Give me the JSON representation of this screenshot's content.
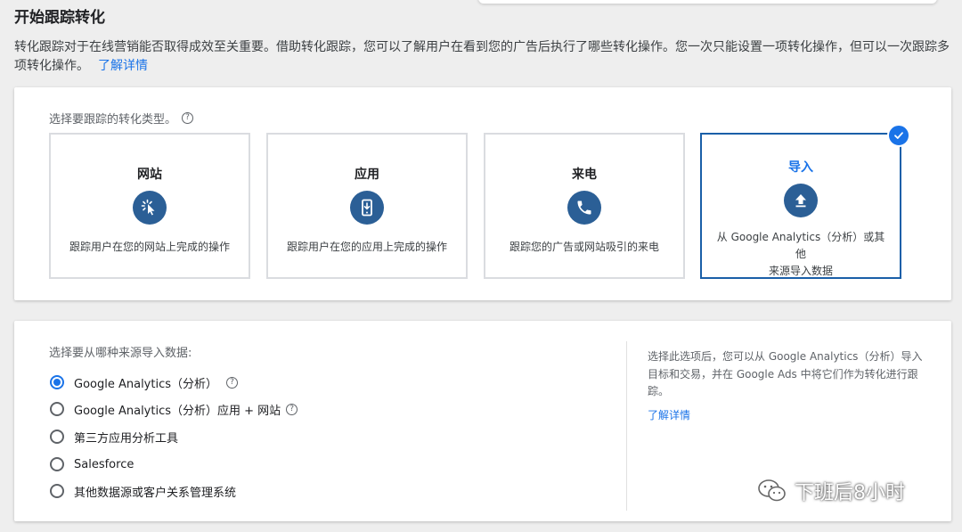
{
  "page": {
    "title": "开始跟踪转化",
    "intro": "转化跟踪对于在线营销能否取得成效至关重要。借助转化跟踪，您可以了解用户在看到您的广告后执行了哪些转化操作。您一次只能设置一项转化操作，但可以一次跟踪多项转化操作。",
    "intro_link": "了解详情"
  },
  "conversion_types": {
    "label": "选择要跟踪的转化类型。",
    "help_glyph": "?",
    "items": [
      {
        "title": "网站",
        "icon": "cursor-click-icon",
        "desc": "跟踪用户在您的网站上完成的操作"
      },
      {
        "title": "应用",
        "icon": "phone-app-icon",
        "desc": "跟踪用户在您的应用上完成的操作"
      },
      {
        "title": "来电",
        "icon": "phone-call-icon",
        "desc": "跟踪您的广告或网站吸引的来电"
      },
      {
        "title": "导入",
        "icon": "upload-icon",
        "desc_line1": "从 Google Analytics（分析）或其他",
        "desc_line2": "来源导入数据",
        "selected": true
      }
    ]
  },
  "import_source": {
    "label": "选择要从哪种来源导入数据:",
    "help_glyph": "?",
    "options": [
      {
        "label": "Google Analytics（分析）",
        "checked": true,
        "has_help": true
      },
      {
        "label": "Google Analytics（分析）应用 + 网站",
        "checked": false,
        "has_help": true
      },
      {
        "label": "第三方应用分析工具",
        "checked": false
      },
      {
        "label": "Salesforce",
        "checked": false
      },
      {
        "label": "其他数据源或客户关系管理系统",
        "checked": false
      }
    ],
    "side_note": "选择此选项后，您可以从 Google Analytics（分析）导入目标和交易，并在 Google Ads 中将它们作为转化进行跟踪。",
    "side_link": "了解详情"
  },
  "watermark": {
    "text": "下班后8小时",
    "icon": "wechat-icon"
  },
  "colors": {
    "accent": "#1a73e8",
    "icon_circle": "#2b5f96",
    "selected_border": "#1a5fa8"
  }
}
